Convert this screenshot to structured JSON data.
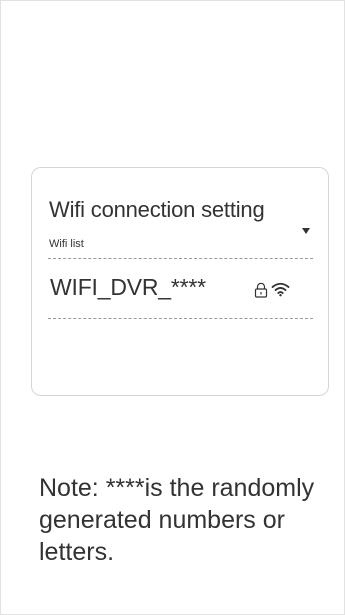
{
  "card": {
    "title": "Wifi connection setting",
    "list_label": "Wifi list",
    "networks": [
      {
        "ssid": "WIFI_DVR_****",
        "secured_icon": "lock-icon",
        "signal_icon": "wifi-signal-icon"
      }
    ]
  },
  "note": {
    "text": "Note: ****is the randomly generated numbers or letters."
  },
  "colors": {
    "text": "#333333",
    "card_border": "#d6d6d6",
    "divider": "#9a9a9a",
    "page_border": "#e2e2e2"
  }
}
